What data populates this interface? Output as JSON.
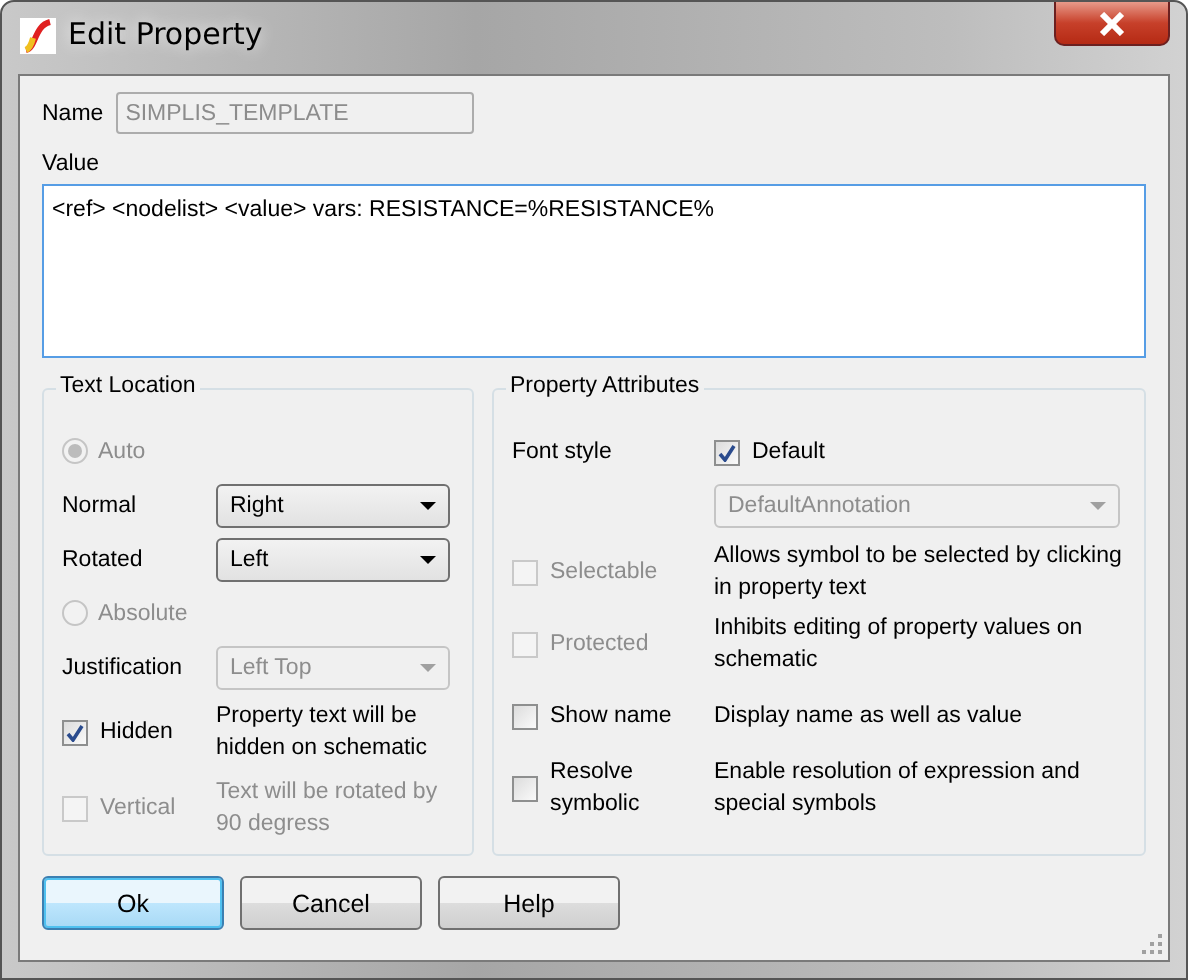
{
  "window": {
    "title": "Edit Property"
  },
  "name": {
    "label": "Name",
    "value": "SIMPLIS_TEMPLATE",
    "disabled": true
  },
  "value": {
    "label": "Value",
    "value": "<ref> <nodelist> <value> vars: RESISTANCE=%RESISTANCE%"
  },
  "text_location": {
    "title": "Text Location",
    "items": [
      {
        "kind": "radio",
        "label": "Auto",
        "selected": true,
        "disabled": true
      },
      {
        "kind": "select",
        "label": "Normal",
        "value": "Right",
        "disabled": false
      },
      {
        "kind": "select",
        "label": "Rotated",
        "value": "Left",
        "disabled": false
      },
      {
        "kind": "radio",
        "label": "Absolute",
        "selected": false,
        "disabled": true
      },
      {
        "kind": "select",
        "label": "Justification",
        "value": "Left Top",
        "disabled": true
      },
      {
        "kind": "checkbox",
        "label": "Hidden",
        "checked": true,
        "disabled": false,
        "description": "Property text will be hidden on schematic"
      },
      {
        "kind": "checkbox",
        "label": "Vertical",
        "checked": false,
        "disabled": true,
        "description": "Text will be rotated by 90 degress"
      }
    ]
  },
  "property_attributes": {
    "title": "Property Attributes",
    "font_style": {
      "label": "Font style",
      "checkbox_label": "Default",
      "checked": true,
      "select_value": "DefaultAnnotation",
      "select_disabled": true
    },
    "options": [
      {
        "label": "Selectable",
        "checked": false,
        "disabled": true,
        "description": "Allows symbol to be selected by clicking in property text"
      },
      {
        "label": "Protected",
        "checked": false,
        "disabled": true,
        "description": "Inhibits editing of property values on schematic"
      },
      {
        "label": "Show name",
        "checked": false,
        "disabled": false,
        "description": "Display name as well as value"
      },
      {
        "label": "Resolve symbolic",
        "checked": false,
        "disabled": false,
        "description": "Enable resolution of expression and special symbols"
      }
    ]
  },
  "buttons": [
    {
      "label": "Ok",
      "default": true
    },
    {
      "label": "Cancel",
      "default": false
    },
    {
      "label": "Help",
      "default": false
    }
  ]
}
